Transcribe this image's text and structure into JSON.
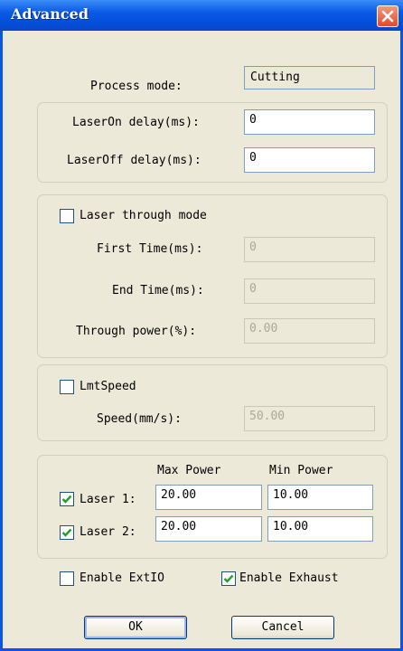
{
  "window": {
    "title": "Advanced"
  },
  "process": {
    "label": "Process mode:",
    "value": "Cutting"
  },
  "delays": {
    "on_label": "LaserOn delay(ms):",
    "on_value": "0",
    "off_label": "LaserOff delay(ms):",
    "off_value": "0"
  },
  "through": {
    "checkbox_label": "Laser through mode",
    "checked": false,
    "first_label": "First Time(ms):",
    "first_value": "0",
    "end_label": "End Time(ms):",
    "end_value": "0",
    "power_label": "Through power(%):",
    "power_value": "0.00"
  },
  "limit": {
    "checkbox_label": "LmtSpeed",
    "checked": false,
    "speed_label": "Speed(mm/s):",
    "speed_value": "50.00"
  },
  "power": {
    "max_header": "Max Power",
    "min_header": "Min Power",
    "laser1_label": "Laser 1:",
    "laser1_checked": true,
    "laser1_max": "20.00",
    "laser1_min": "10.00",
    "laser2_label": "Laser 2:",
    "laser2_checked": true,
    "laser2_max": "20.00",
    "laser2_min": "10.00"
  },
  "options": {
    "extio_label": "Enable ExtIO",
    "extio_checked": false,
    "exhaust_label": "Enable Exhaust",
    "exhaust_checked": true
  },
  "buttons": {
    "ok": "OK",
    "cancel": "Cancel"
  },
  "colors": {
    "title_bar": "#0a5ae6",
    "dialog_bg": "#ece9d8",
    "check_green": "#21a121"
  }
}
